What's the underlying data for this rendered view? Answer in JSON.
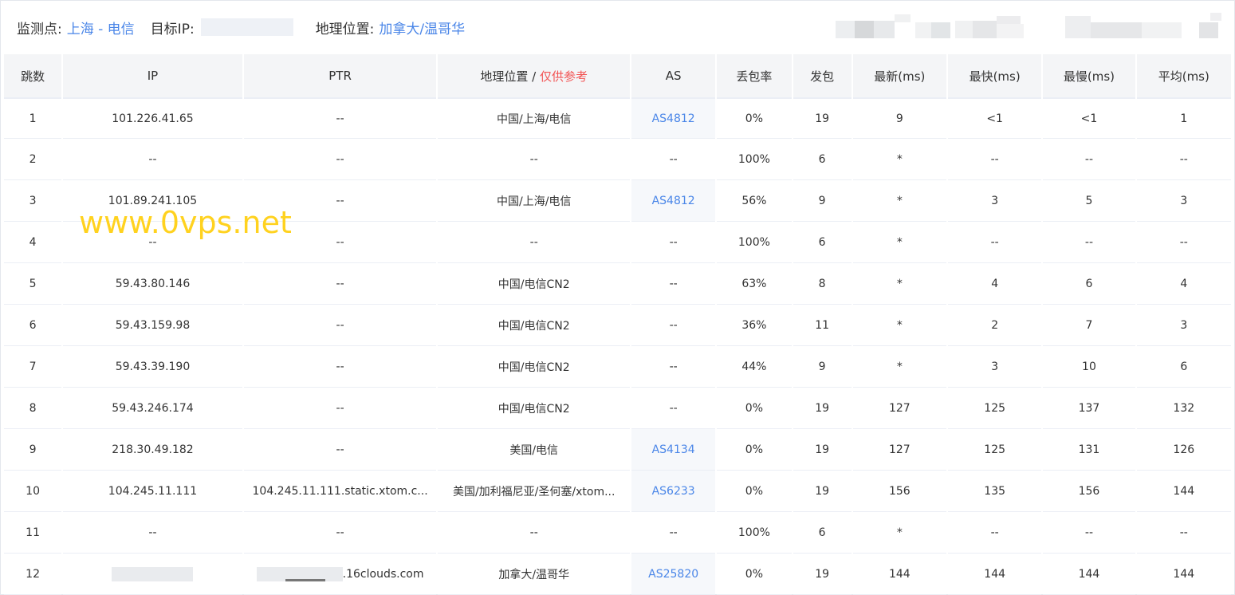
{
  "header": {
    "monitor_label": "监测点:",
    "monitor_value": "上海 - 电信",
    "target_label": "目标IP:",
    "geo_label": "地理位置:",
    "geo_value": "加拿大/温哥华"
  },
  "columns": {
    "hop": "跳数",
    "ip": "IP",
    "ptr": "PTR",
    "geo": "地理位置",
    "geo_sep": " / ",
    "geo_ref": "仅供参考",
    "as": "AS",
    "loss": "丢包率",
    "sent": "发包",
    "last": "最新(ms)",
    "best": "最快(ms)",
    "worst": "最慢(ms)",
    "avg": "平均(ms)"
  },
  "rows": [
    {
      "hop": "1",
      "ip": "101.226.41.65",
      "ptr": "--",
      "geo": "中国/上海/电信",
      "as": "AS4812",
      "loss": "0%",
      "sent": "19",
      "last": "9",
      "best": "<1",
      "worst": "<1",
      "avg": "1"
    },
    {
      "hop": "2",
      "ip": "--",
      "ptr": "--",
      "geo": "--",
      "as": "--",
      "loss": "100%",
      "sent": "6",
      "last": "*",
      "best": "--",
      "worst": "--",
      "avg": "--"
    },
    {
      "hop": "3",
      "ip": "101.89.241.105",
      "ptr": "--",
      "geo": "中国/上海/电信",
      "as": "AS4812",
      "loss": "56%",
      "sent": "9",
      "last": "*",
      "best": "3",
      "worst": "5",
      "avg": "3"
    },
    {
      "hop": "4",
      "ip": "--",
      "ptr": "--",
      "geo": "--",
      "as": "--",
      "loss": "100%",
      "sent": "6",
      "last": "*",
      "best": "--",
      "worst": "--",
      "avg": "--"
    },
    {
      "hop": "5",
      "ip": "59.43.80.146",
      "ptr": "--",
      "geo": "中国/电信CN2",
      "as": "--",
      "loss": "63%",
      "sent": "8",
      "last": "*",
      "best": "4",
      "worst": "6",
      "avg": "4"
    },
    {
      "hop": "6",
      "ip": "59.43.159.98",
      "ptr": "--",
      "geo": "中国/电信CN2",
      "as": "--",
      "loss": "36%",
      "sent": "11",
      "last": "*",
      "best": "2",
      "worst": "7",
      "avg": "3"
    },
    {
      "hop": "7",
      "ip": "59.43.39.190",
      "ptr": "--",
      "geo": "中国/电信CN2",
      "as": "--",
      "loss": "44%",
      "sent": "9",
      "last": "*",
      "best": "3",
      "worst": "10",
      "avg": "6"
    },
    {
      "hop": "8",
      "ip": "59.43.246.174",
      "ptr": "--",
      "geo": "中国/电信CN2",
      "as": "--",
      "loss": "0%",
      "sent": "19",
      "last": "127",
      "best": "125",
      "worst": "137",
      "avg": "132"
    },
    {
      "hop": "9",
      "ip": "218.30.49.182",
      "ptr": "--",
      "geo": "美国/电信",
      "as": "AS4134",
      "loss": "0%",
      "sent": "19",
      "last": "127",
      "best": "125",
      "worst": "131",
      "avg": "126"
    },
    {
      "hop": "10",
      "ip": "104.245.11.111",
      "ptr": "104.245.11.111.static.xtom.c...",
      "geo": "美国/加利福尼亚/圣何塞/xtom...",
      "as": "AS6233",
      "loss": "0%",
      "sent": "19",
      "last": "156",
      "best": "135",
      "worst": "156",
      "avg": "144"
    },
    {
      "hop": "11",
      "ip": "--",
      "ptr": "--",
      "geo": "--",
      "as": "--",
      "loss": "100%",
      "sent": "6",
      "last": "*",
      "best": "--",
      "worst": "--",
      "avg": "--"
    },
    {
      "hop": "12",
      "ip": "",
      "ptr": ".16clouds.com",
      "geo": "加拿大/温哥华",
      "as": "AS25820",
      "loss": "0%",
      "sent": "19",
      "last": "144",
      "best": "144",
      "worst": "144",
      "avg": "144"
    }
  ],
  "watermark": "www.0vps.net",
  "colors": {
    "link": "#4a86e8",
    "reference_red": "#f25454",
    "header_bg": "#f4f5f7",
    "watermark": "#ffd21f"
  }
}
